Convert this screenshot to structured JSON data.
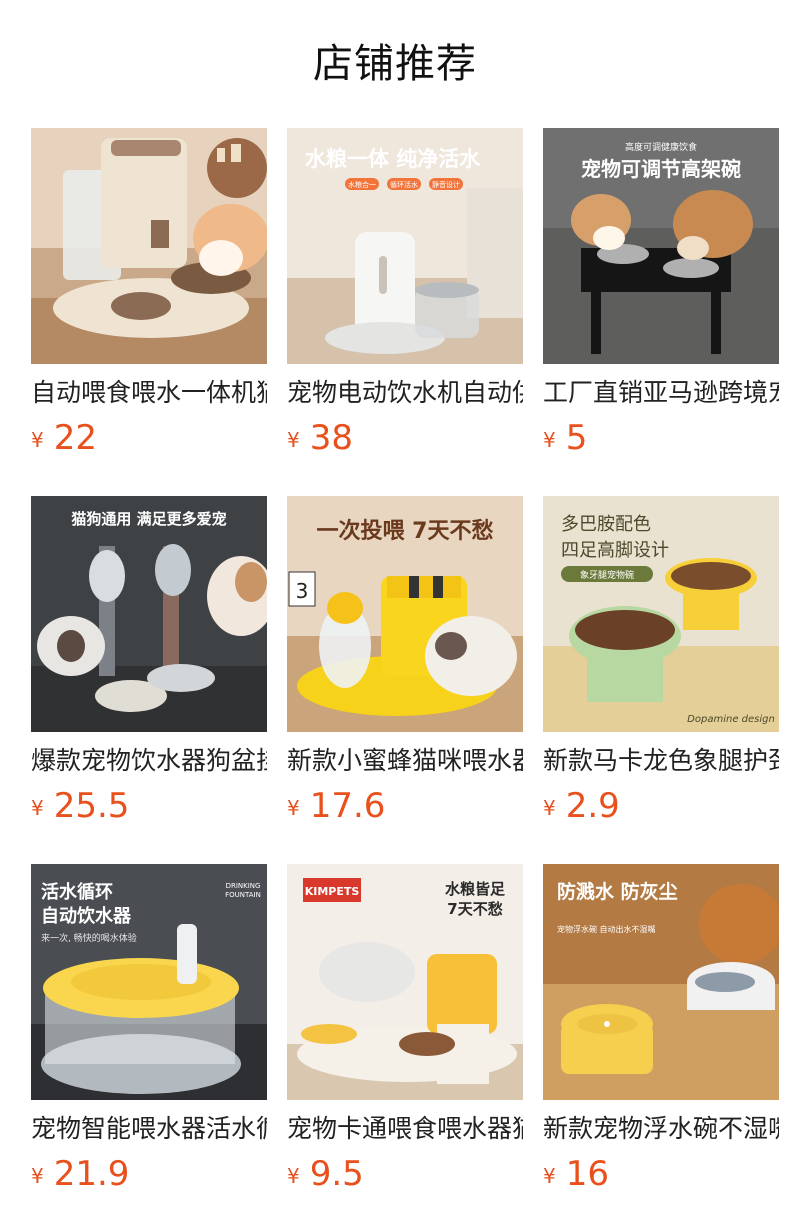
{
  "page": {
    "title": "店铺推荐"
  },
  "products": [
    {
      "name": "自动喂食喂水一体机猫",
      "currency": "¥",
      "price": "22",
      "image": {
        "headline": "",
        "sub": ""
      }
    },
    {
      "name": "宠物电动饮水机自动供",
      "currency": "¥",
      "price": "38",
      "image": {
        "headline": "水粮一体 纯净活水",
        "tags": [
          "水粮合一",
          "循环活水",
          "静音设计"
        ]
      }
    },
    {
      "name": "工厂直销亚马逊跨境宠",
      "currency": "¥",
      "price": "5",
      "image": {
        "kicker": "高度可调健康饮食",
        "headline": "宠物可调节高架碗",
        "sub": ""
      }
    },
    {
      "name": "爆款宠物饮水器狗盆挂",
      "currency": "¥",
      "price": "25.5",
      "image": {
        "headline": "猫狗通用 满足更多爱宠"
      }
    },
    {
      "name": "新款小蜜蜂猫咪喂水器",
      "currency": "¥",
      "price": "17.6",
      "image": {
        "headline": "一次投喂 7天不愁",
        "calendar": "3"
      }
    },
    {
      "name": "新款马卡龙色象腿护颈",
      "currency": "¥",
      "price": "2.9",
      "image": {
        "line1": "多巴胺配色",
        "line2": "四足高脚设计",
        "tag": "象牙腿宠物碗",
        "signature": "Dopamine design"
      }
    },
    {
      "name": "宠物智能喂水器活水循",
      "currency": "¥",
      "price": "21.9",
      "image": {
        "line1": "活水循环",
        "line2": "自动饮水器",
        "sub": "来一次, 畅快的喝水体验",
        "badge_line1": "DRINKING",
        "badge_line2": "FOUNTAIN"
      }
    },
    {
      "name": "宠物卡通喂食喂水器猫",
      "currency": "¥",
      "price": "9.5",
      "image": {
        "brand": "KIMPETS",
        "line1": "水粮皆足",
        "line2": "7天不愁"
      }
    },
    {
      "name": "新款宠物浮水碗不湿嘴",
      "currency": "¥",
      "price": "16",
      "image": {
        "headline": "防溅水 防灰尘",
        "sub": "宠物浮水碗 自动出水不湿嘴"
      }
    }
  ]
}
